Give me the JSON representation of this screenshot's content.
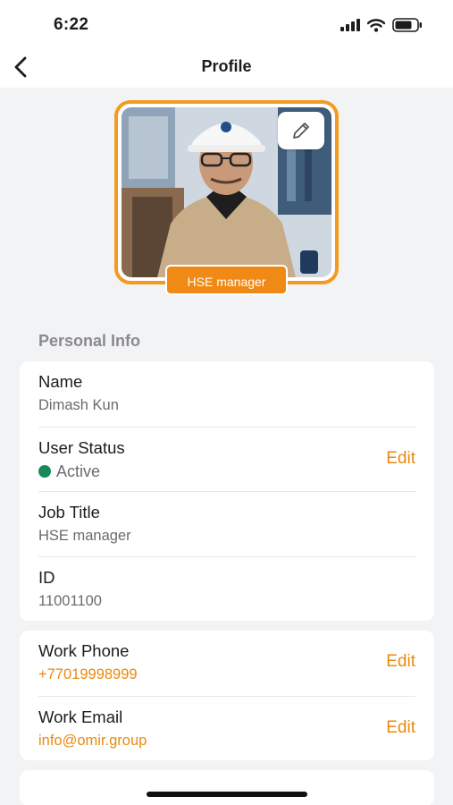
{
  "status_bar": {
    "time": "6:22"
  },
  "nav": {
    "title": "Profile"
  },
  "profile": {
    "role_badge": "HSE manager"
  },
  "personal_info": {
    "section_title": "Personal Info",
    "name": {
      "label": "Name",
      "value": "Dimash Kun"
    },
    "user_status": {
      "label": "User Status",
      "value": "Active",
      "action": "Edit"
    },
    "job_title": {
      "label": "Job Title",
      "value": "HSE manager"
    },
    "id": {
      "label": "ID",
      "value": "11001100"
    }
  },
  "contact": {
    "work_phone": {
      "label": "Work Phone",
      "value": "+77019998999",
      "action": "Edit"
    },
    "work_email": {
      "label": "Work Email",
      "value": "info@omir.group",
      "action": "Edit"
    }
  },
  "colors": {
    "accent": "#f08a16",
    "active": "#188a58"
  },
  "icons": [
    "back-chevron-icon",
    "pencil-icon",
    "signal-icon",
    "wifi-icon",
    "battery-icon"
  ]
}
